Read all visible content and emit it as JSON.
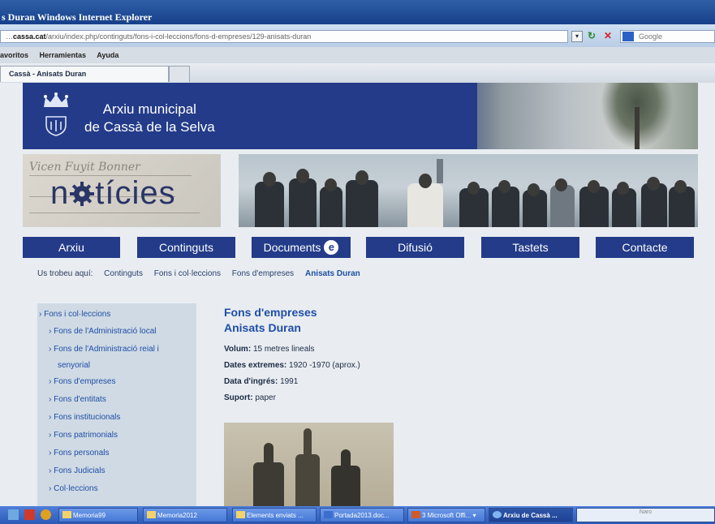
{
  "window": {
    "title": "s Duran   Windows Internet Explorer"
  },
  "address_bar": {
    "domain": "cassa.cat",
    "path": "/arxiu/index.php/continguts/fons-i-col-leccions/fons-d-empreses/129-anisats-duran",
    "prefix": "…",
    "search_placeholder": "Google"
  },
  "menu": {
    "items": [
      "avoritos",
      "Herramientas",
      "Ayuda"
    ]
  },
  "tab": {
    "label": "Cassà - Anisats Duran"
  },
  "banner": {
    "line1": "Arxiu municipal",
    "line2": "de Cassà de la Selva"
  },
  "noticies": {
    "before": "n",
    "after": "tícies",
    "script_text": "Vicen Fuyit Bonner"
  },
  "nav": [
    {
      "label": "Arxiu"
    },
    {
      "label": "Continguts"
    },
    {
      "label": "Documents",
      "badge": "e"
    },
    {
      "label": "Difusió"
    },
    {
      "label": "Tastets"
    },
    {
      "label": "Contacte"
    }
  ],
  "breadcrumb": {
    "intro": "Us trobeu aquí:",
    "items": [
      "Continguts",
      "Fons i col·leccions",
      "Fons d'empreses"
    ],
    "current": "Anisats Duran"
  },
  "sidebar": {
    "top": "Fons i col·leccions",
    "items": [
      "Fons de l'Administració local",
      "Fons de l'Administració reial i",
      "senyorial",
      "Fons d'empreses",
      "Fons d'entitats",
      "Fons institucionals",
      "Fons patrimonials",
      "Fons personals",
      "Fons Judicials",
      "Col·leccions"
    ]
  },
  "content": {
    "heading1": "Fons d'empreses",
    "heading2": "Anisats Duran",
    "fields": [
      {
        "label": "Volum:",
        "value": "15 metres lineals"
      },
      {
        "label": "Dates extremes:",
        "value": "1920 -1970 (aprox.)"
      },
      {
        "label": "Data d'ingrés:",
        "value": "1991"
      },
      {
        "label": "Suport:",
        "value": "paper"
      }
    ]
  },
  "taskbar": {
    "items": [
      "Memoria99",
      "Memoria2012",
      "Elements enviats ...",
      "Portada2013.doc...",
      "3 Microsoft Offi... ▾",
      "Arxiu de Cassà ..."
    ],
    "right_text": "Naro"
  },
  "colors": {
    "brand_blue": "#233b89",
    "link_blue": "#1f4ea6",
    "sidebar_bg": "#cfdae4"
  }
}
